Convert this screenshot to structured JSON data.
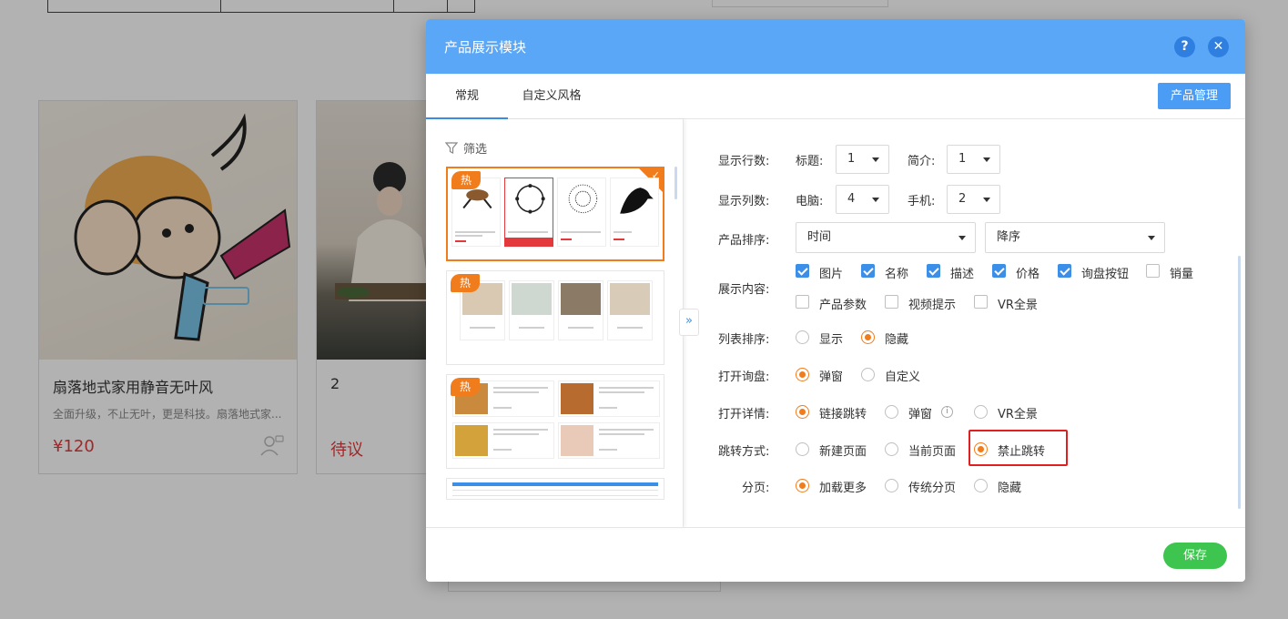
{
  "background": {
    "cards": [
      {
        "title": "扇落地式家用静音无叶风",
        "desc": "全面升级，不止无叶，更是科技。扇落地式家...",
        "price": "¥120"
      },
      {
        "title": "2",
        "desc": "",
        "price": "待议"
      }
    ]
  },
  "dialog": {
    "title": "产品展示模块",
    "help_label": "?",
    "close_label": "✕",
    "tabs": [
      {
        "label": "常规",
        "active": true
      },
      {
        "label": "自定义风格",
        "active": false
      }
    ],
    "manage_button": "产品管理",
    "save_button": "保存"
  },
  "left": {
    "filter_label": "筛选",
    "templates": [
      {
        "badge": "热",
        "selected": true
      },
      {
        "badge": "热",
        "selected": false
      },
      {
        "badge": "热",
        "selected": false
      },
      {
        "badge": "",
        "selected": false
      }
    ],
    "expand_label": "»"
  },
  "form": {
    "rows_label": "显示行数:",
    "title_label": "标题:",
    "title_value": "1",
    "intro_label": "简介:",
    "intro_value": "1",
    "cols_label": "显示列数:",
    "pc_label": "电脑:",
    "pc_value": "4",
    "mobile_label": "手机:",
    "mobile_value": "2",
    "sort_label": "产品排序:",
    "sort_field": "时间",
    "sort_order": "降序",
    "content_label": "展示内容:",
    "content_options": [
      {
        "label": "图片",
        "checked": true
      },
      {
        "label": "名称",
        "checked": true
      },
      {
        "label": "描述",
        "checked": true
      },
      {
        "label": "价格",
        "checked": true
      },
      {
        "label": "询盘按钮",
        "checked": true
      },
      {
        "label": "销量",
        "checked": false
      },
      {
        "label": "产品参数",
        "checked": false
      },
      {
        "label": "视频提示",
        "checked": false
      },
      {
        "label": "VR全景",
        "checked": false
      }
    ],
    "list_sort_label": "列表排序:",
    "list_sort_options": [
      {
        "label": "显示",
        "selected": false
      },
      {
        "label": "隐藏",
        "selected": true
      }
    ],
    "inquiry_label": "打开询盘:",
    "inquiry_options": [
      {
        "label": "弹窗",
        "selected": true
      },
      {
        "label": "自定义",
        "selected": false
      }
    ],
    "detail_label": "打开详情:",
    "detail_options": [
      {
        "label": "链接跳转",
        "selected": true
      },
      {
        "label": "弹窗",
        "selected": false
      },
      {
        "label": "VR全景",
        "selected": false
      }
    ],
    "detail_info_icon": "i",
    "jump_label": "跳转方式:",
    "jump_options": [
      {
        "label": "新建页面",
        "selected": false
      },
      {
        "label": "当前页面",
        "selected": false
      },
      {
        "label": "禁止跳转",
        "selected": true
      }
    ],
    "paging_label": "分页:",
    "paging_options": [
      {
        "label": "加载更多",
        "selected": true
      },
      {
        "label": "传统分页",
        "selected": false
      },
      {
        "label": "隐藏",
        "selected": false
      }
    ]
  },
  "colors": {
    "header": "#5aa7f7",
    "accent": "#f07c1c",
    "checkbox": "#3b8fe8",
    "save": "#3ec54f",
    "price": "#e4393c",
    "highlight": "#e02020"
  }
}
